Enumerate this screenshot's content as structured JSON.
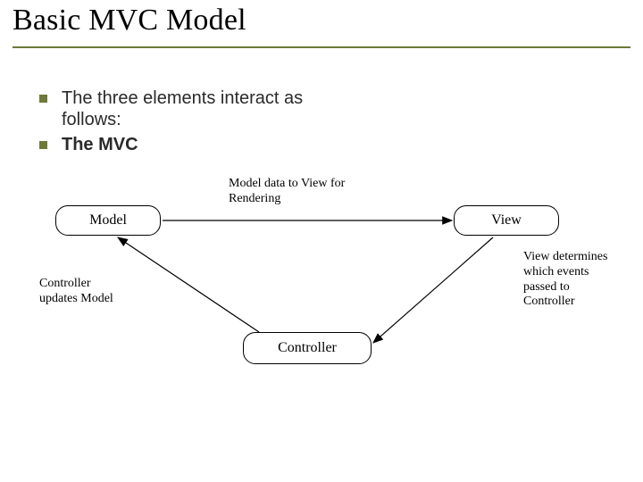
{
  "title": "Basic MVC Model",
  "bullets": [
    {
      "text": "The three elements interact as follows:",
      "bold": false
    },
    {
      "text": "The MVC",
      "bold": true
    }
  ],
  "diagram": {
    "nodes": {
      "model": "Model",
      "view": "View",
      "controller": "Controller"
    },
    "edges": {
      "model_to_view": "Model data to View for Rendering",
      "view_to_controller": "View determines which events passed to Controller",
      "controller_to_model": "Controller updates Model"
    }
  }
}
